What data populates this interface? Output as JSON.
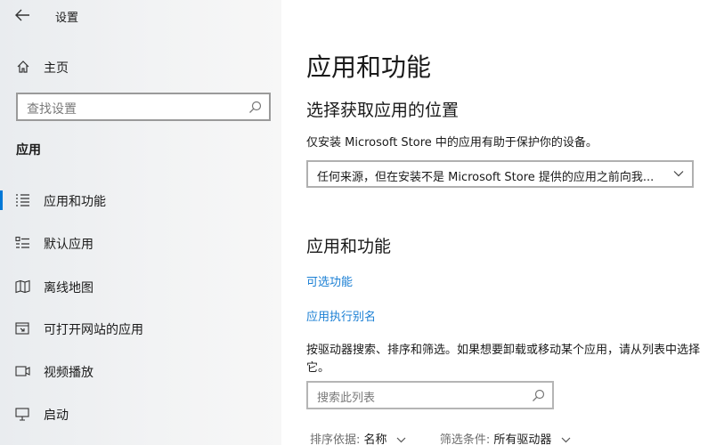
{
  "window": {
    "title": "设置"
  },
  "sidebar": {
    "home_label": "主页",
    "search_placeholder": "查找设置",
    "section": "应用",
    "items": [
      {
        "label": "应用和功能",
        "icon": "apps-list-icon",
        "selected": true
      },
      {
        "label": "默认应用",
        "icon": "default-apps-icon",
        "selected": false
      },
      {
        "label": "离线地图",
        "icon": "offline-map-icon",
        "selected": false
      },
      {
        "label": "可打开网站的应用",
        "icon": "open-web-apps-icon",
        "selected": false
      },
      {
        "label": "视频播放",
        "icon": "video-playback-icon",
        "selected": false
      },
      {
        "label": "启动",
        "icon": "startup-icon",
        "selected": false
      }
    ]
  },
  "main": {
    "title": "应用和功能",
    "install_section": {
      "heading": "选择获取应用的位置",
      "description": "仅安装 Microsoft Store 中的应用有助于保护你的设备。",
      "dropdown_value": "任何来源，但在安装不是 Microsoft Store 提供的应用之前向我..."
    },
    "features_section": {
      "heading": "应用和功能",
      "link_optional": "可选功能",
      "link_alias": "应用执行别名",
      "description": "按驱动器搜索、排序和筛选。如果想要卸载或移动某个应用，请从列表中选择它。",
      "search_placeholder": "搜索此列表",
      "sort_label": "排序依据:",
      "sort_value": "名称",
      "filter_label": "筛选条件:",
      "filter_value": "所有驱动器"
    }
  },
  "colors": {
    "accent": "#0078d7",
    "link": "#1a7fd4"
  }
}
